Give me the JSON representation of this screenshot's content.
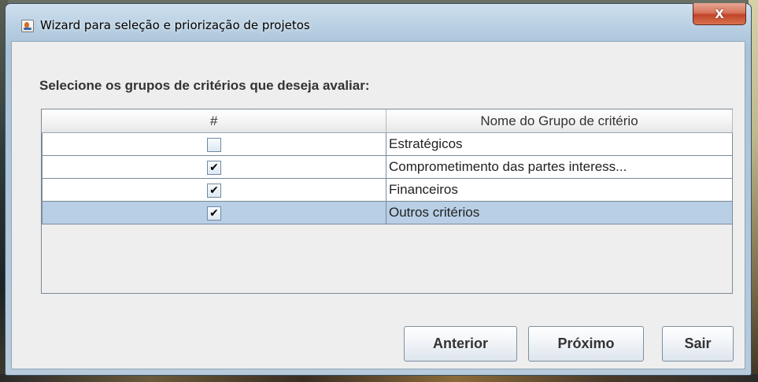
{
  "window": {
    "title": "Wizard para seleção e priorização de projetos",
    "close_label": "X"
  },
  "content": {
    "prompt": "Selecione os grupos de critérios que deseja avaliar:"
  },
  "table": {
    "columns": [
      "#",
      "Nome do Grupo de critério"
    ],
    "rows": [
      {
        "checked": false,
        "check_mark": "",
        "name": "Estratégicos",
        "selected": false
      },
      {
        "checked": true,
        "check_mark": "✔",
        "name": "Comprometimento das partes interess...",
        "selected": false
      },
      {
        "checked": true,
        "check_mark": "✔",
        "name": "Financeiros",
        "selected": false
      },
      {
        "checked": true,
        "check_mark": "✔",
        "name": "Outros critérios",
        "selected": true
      }
    ]
  },
  "buttons": {
    "previous": "Anterior",
    "next": "Próximo",
    "exit": "Sair"
  },
  "colors": {
    "selected_row": "#b8cfe5",
    "client_bg": "#eeeeee",
    "close_button": "#c1442a"
  }
}
